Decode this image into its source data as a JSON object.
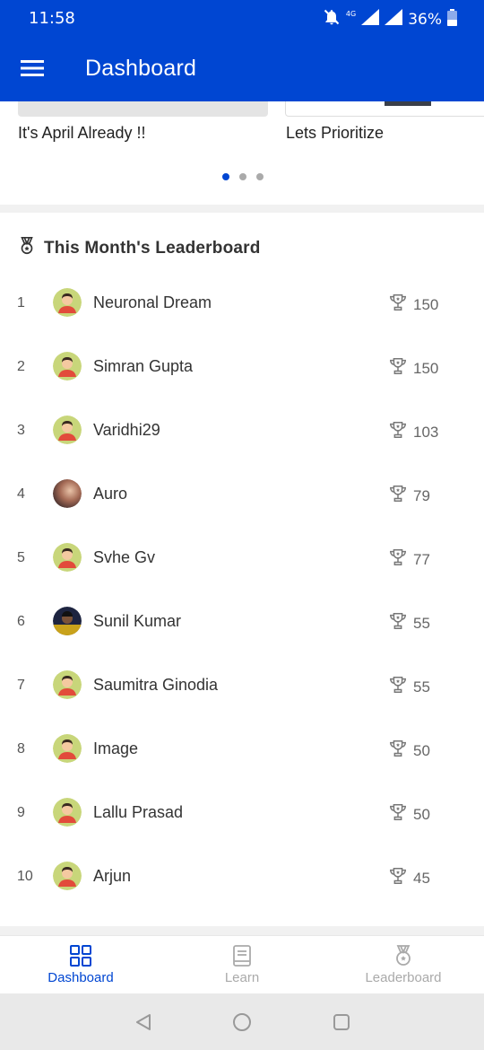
{
  "status_bar": {
    "time": "11:58",
    "network": "4G",
    "battery": "36%"
  },
  "app_bar": {
    "title": "Dashboard",
    "menu_icon": "hamburger-menu-icon"
  },
  "carousel": {
    "cards": [
      {
        "caption": "It's April Already !!"
      },
      {
        "caption": "Lets Prioritize"
      }
    ],
    "page_count": 3,
    "active_page": 1
  },
  "leaderboard": {
    "title": "This Month's Leaderboard",
    "icon": "medal-icon",
    "score_icon": "trophy-icon",
    "rows": [
      {
        "rank": "1",
        "name": "Neuronal Dream",
        "score": "150",
        "avatar": "default-avatar"
      },
      {
        "rank": "2",
        "name": "Simran Gupta",
        "score": "150",
        "avatar": "default-avatar"
      },
      {
        "rank": "3",
        "name": "Varidhi29",
        "score": "103",
        "avatar": "default-avatar"
      },
      {
        "rank": "4",
        "name": "Auro",
        "score": "79",
        "avatar": "photo-avatar"
      },
      {
        "rank": "5",
        "name": "Svhe Gv",
        "score": "77",
        "avatar": "default-avatar"
      },
      {
        "rank": "6",
        "name": "Sunil Kumar",
        "score": "55",
        "avatar": "photo-avatar-dark"
      },
      {
        "rank": "7",
        "name": "Saumitra Ginodia",
        "score": "55",
        "avatar": "default-avatar"
      },
      {
        "rank": "8",
        "name": "Image",
        "score": "50",
        "avatar": "default-avatar"
      },
      {
        "rank": "9",
        "name": "Lallu Prasad",
        "score": "50",
        "avatar": "default-avatar"
      },
      {
        "rank": "10",
        "name": "Arjun",
        "score": "45",
        "avatar": "default-avatar"
      }
    ]
  },
  "bottom_nav": {
    "tabs": [
      {
        "label": "Dashboard",
        "icon": "grid-icon",
        "active": true
      },
      {
        "label": "Learn",
        "icon": "book-icon",
        "active": false
      },
      {
        "label": "Leaderboard",
        "icon": "medal-icon",
        "active": false
      }
    ]
  },
  "colors": {
    "primary": "#0046d2",
    "avatar_bg": "#c8d67a",
    "avatar_body": "#e24b3b"
  }
}
